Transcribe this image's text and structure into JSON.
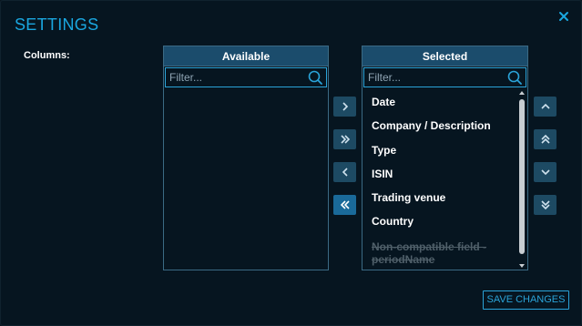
{
  "dialog": {
    "title": "SETTINGS",
    "columns_label": "Columns:",
    "save_label": "SAVE CHANGES"
  },
  "available": {
    "header": "Available",
    "filter_placeholder": "Filter...",
    "items": []
  },
  "selected": {
    "header": "Selected",
    "filter_placeholder": "Filter...",
    "items": [
      {
        "label": "Date"
      },
      {
        "label": "Company / Description"
      },
      {
        "label": "Type"
      },
      {
        "label": "ISIN"
      },
      {
        "label": "Trading venue"
      },
      {
        "label": "Country"
      }
    ],
    "disabled_item": "Non-compatible field - periodName"
  },
  "icons": {
    "close": "close-icon",
    "search": "search-icon",
    "move_right": "chevron-right-icon",
    "move_all_right": "double-chevron-right-icon",
    "move_left": "chevron-left-icon",
    "move_all_left": "double-chevron-left-icon",
    "move_up": "chevron-up-icon",
    "move_top": "double-chevron-up-icon",
    "move_down": "chevron-down-icon",
    "move_bottom": "double-chevron-down-icon"
  },
  "colors": {
    "accent": "#1aa7e0",
    "background": "#061520",
    "header": "#1b4c6c",
    "button": "#1d4a63",
    "button_active": "#1a6a9a",
    "disabled_text": "#4f5f69"
  }
}
